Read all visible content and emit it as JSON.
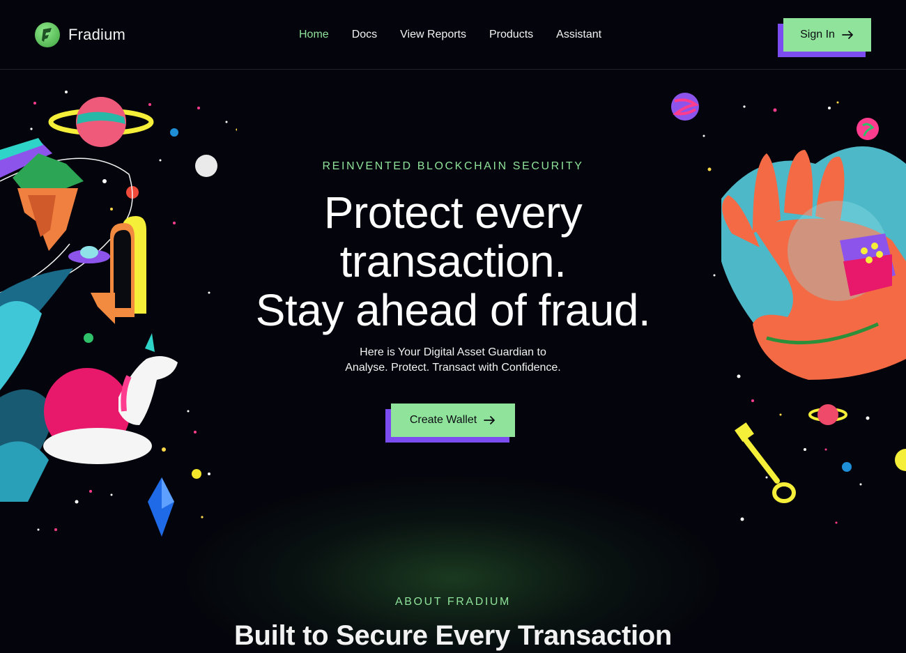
{
  "header": {
    "brand": "Fradium",
    "nav": [
      {
        "label": "Home",
        "active": true
      },
      {
        "label": "Docs",
        "active": false
      },
      {
        "label": "View Reports",
        "active": false
      },
      {
        "label": "Products",
        "active": false
      },
      {
        "label": "Assistant",
        "active": false
      }
    ],
    "signin_label": "Sign In"
  },
  "hero": {
    "eyebrow": "REINVENTED BLOCKCHAIN SECURITY",
    "title_lines": [
      "Protect every",
      "transaction.",
      "Stay ahead of fraud."
    ],
    "subtitle_lines": [
      "Here is Your Digital Asset Guardian to",
      "Analyse. Protect. Transact with Confidence."
    ],
    "cta_label": "Create Wallet"
  },
  "about": {
    "eyebrow": "ABOUT FRADIUM",
    "title": "Built to Secure Every Transaction"
  },
  "colors": {
    "background": "#04050c",
    "accent_green": "#8fe39a",
    "accent_purple": "#7b4cf0",
    "text": "#ffffff"
  },
  "icons": [
    "fradium-logo-icon",
    "arrow-right-icon"
  ]
}
